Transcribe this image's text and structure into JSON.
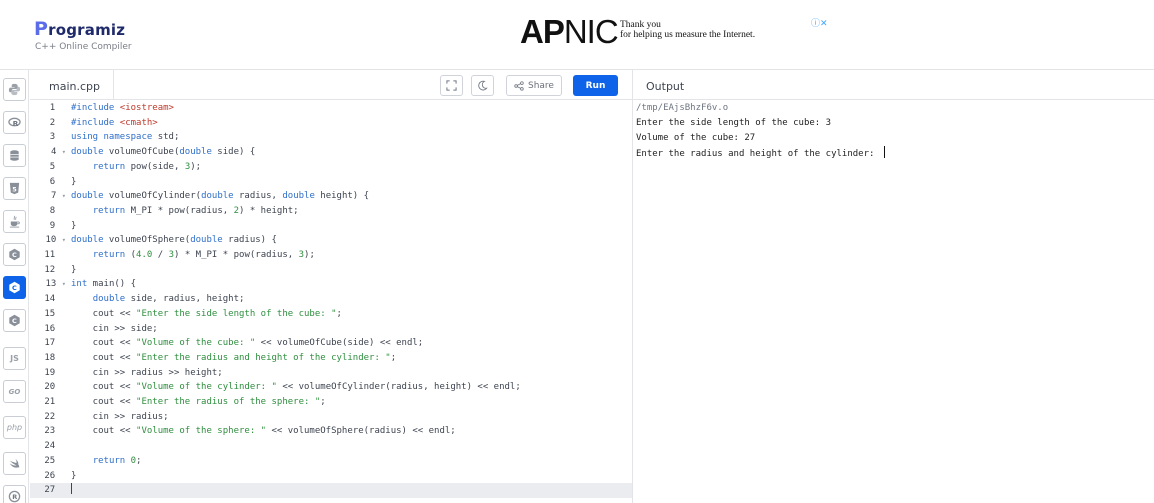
{
  "header": {
    "logo_initial": "P",
    "logo_rest": "rogramiz",
    "subtitle": "C++ Online Compiler"
  },
  "ad": {
    "brand_bold": "AP",
    "brand_rest": "NIC",
    "tag_line1": "Thank you",
    "tag_line2": "for helping us measure the Internet.",
    "ad_icons": "ⓘ✕"
  },
  "sidebar": {
    "items": [
      {
        "name": "python",
        "label": ""
      },
      {
        "name": "r",
        "label": "R"
      },
      {
        "name": "sql",
        "label": ""
      },
      {
        "name": "html",
        "label": "5"
      },
      {
        "name": "java",
        "label": ""
      },
      {
        "name": "c",
        "label": "C"
      },
      {
        "name": "cpp",
        "label": "C"
      },
      {
        "name": "csharp",
        "label": "C"
      },
      {
        "name": "js",
        "label": "JS"
      },
      {
        "name": "go",
        "label": "GO"
      },
      {
        "name": "php",
        "label": "php"
      },
      {
        "name": "swift",
        "label": ""
      },
      {
        "name": "rust",
        "label": "R"
      }
    ]
  },
  "editor": {
    "file_tab": "main.cpp",
    "share_label": "Share",
    "run_label": "Run",
    "line_numbers": [
      "1",
      "2",
      "3",
      "4",
      "5",
      "6",
      "7",
      "8",
      "9",
      "10",
      "11",
      "12",
      "13",
      "14",
      "15",
      "16",
      "17",
      "18",
      "19",
      "20",
      "21",
      "22",
      "23",
      "24",
      "25",
      "26",
      "27"
    ],
    "lines": [
      "#include <iostream>",
      "#include <cmath>",
      "using namespace std;",
      "double volumeOfCube(double side) {",
      "    return pow(side, 3);",
      "}",
      "double volumeOfCylinder(double radius, double height) {",
      "    return M_PI * pow(radius, 2) * height;",
      "}",
      "double volumeOfSphere(double radius) {",
      "    return (4.0 / 3) * M_PI * pow(radius, 3);",
      "}",
      "int main() {",
      "    double side, radius, height;",
      "    cout << \"Enter the side length of the cube: \";",
      "    cin >> side;",
      "    cout << \"Volume of the cube: \" << volumeOfCube(side) << endl;",
      "    cout << \"Enter the radius and height of the cylinder: \";",
      "    cin >> radius >> height;",
      "    cout << \"Volume of the cylinder: \" << volumeOfCylinder(radius, height) << endl;",
      "    cout << \"Enter the radius of the sphere: \";",
      "    cin >> radius;",
      "    cout << \"Volume of the sphere: \" << volumeOfSphere(radius) << endl;",
      "",
      "    return 0;",
      "}",
      ""
    ]
  },
  "output": {
    "title": "Output",
    "lines": [
      "/tmp/EAjsBhzF6v.o",
      "Enter the side length of the cube: 3",
      "Volume of the cube: 27",
      "Enter the radius and height of the cylinder: "
    ]
  }
}
